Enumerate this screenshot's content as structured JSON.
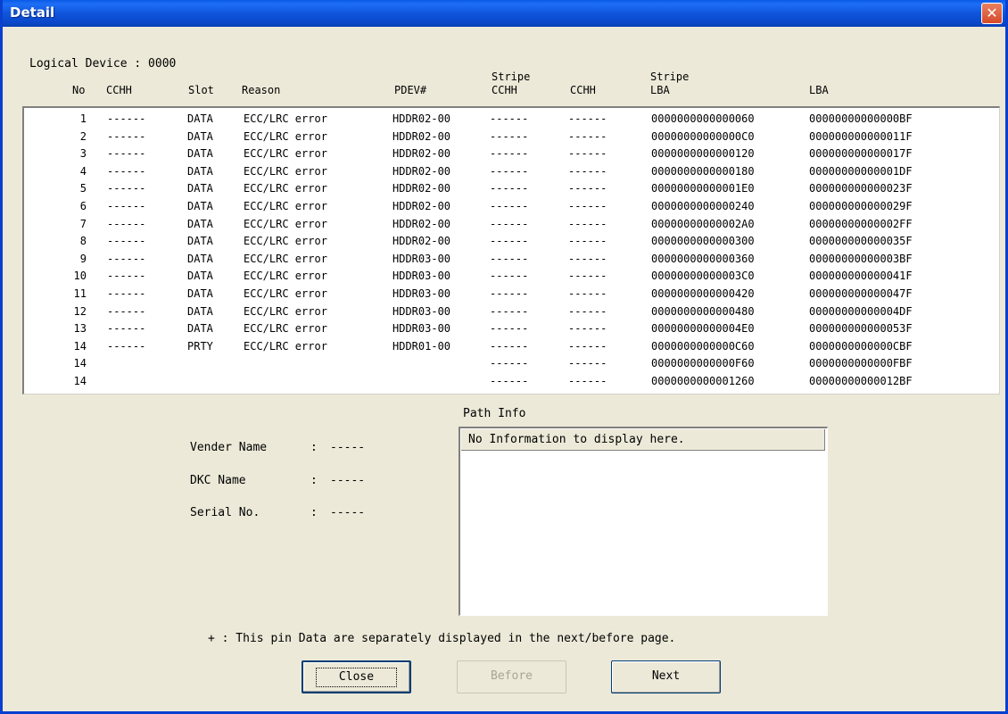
{
  "window": {
    "title": "Detail",
    "close_glyph": "✕"
  },
  "logical_device": "Logical Device : 0000",
  "columns": {
    "no": "No",
    "cchh": "CCHH",
    "slot": "Slot",
    "reason": "Reason",
    "pdev": "PDEV#",
    "stripe_cchh_top": "Stripe",
    "stripe_cchh_bottom": "CCHH",
    "cchh2": "CCHH",
    "stripe_lba_top": "Stripe",
    "stripe_lba_bottom": "LBA",
    "lba": "LBA"
  },
  "rows": [
    {
      "no": "1",
      "cchh": "------",
      "slot": "DATA",
      "reason": "ECC/LRC error",
      "pdev": "HDDR02-00",
      "scchh": "------",
      "cchh2": "------",
      "slba": "0000000000000060",
      "lba": "00000000000000BF"
    },
    {
      "no": "2",
      "cchh": "------",
      "slot": "DATA",
      "reason": "ECC/LRC error",
      "pdev": "HDDR02-00",
      "scchh": "------",
      "cchh2": "------",
      "slba": "00000000000000C0",
      "lba": "000000000000011F"
    },
    {
      "no": "3",
      "cchh": "------",
      "slot": "DATA",
      "reason": "ECC/LRC error",
      "pdev": "HDDR02-00",
      "scchh": "------",
      "cchh2": "------",
      "slba": "0000000000000120",
      "lba": "000000000000017F"
    },
    {
      "no": "4",
      "cchh": "------",
      "slot": "DATA",
      "reason": "ECC/LRC error",
      "pdev": "HDDR02-00",
      "scchh": "------",
      "cchh2": "------",
      "slba": "0000000000000180",
      "lba": "00000000000001DF"
    },
    {
      "no": "5",
      "cchh": "------",
      "slot": "DATA",
      "reason": "ECC/LRC error",
      "pdev": "HDDR02-00",
      "scchh": "------",
      "cchh2": "------",
      "slba": "00000000000001E0",
      "lba": "000000000000023F"
    },
    {
      "no": "6",
      "cchh": "------",
      "slot": "DATA",
      "reason": "ECC/LRC error",
      "pdev": "HDDR02-00",
      "scchh": "------",
      "cchh2": "------",
      "slba": "0000000000000240",
      "lba": "000000000000029F"
    },
    {
      "no": "7",
      "cchh": "------",
      "slot": "DATA",
      "reason": "ECC/LRC error",
      "pdev": "HDDR02-00",
      "scchh": "------",
      "cchh2": "------",
      "slba": "00000000000002A0",
      "lba": "00000000000002FF"
    },
    {
      "no": "8",
      "cchh": "------",
      "slot": "DATA",
      "reason": "ECC/LRC error",
      "pdev": "HDDR02-00",
      "scchh": "------",
      "cchh2": "------",
      "slba": "0000000000000300",
      "lba": "000000000000035F"
    },
    {
      "no": "9",
      "cchh": "------",
      "slot": "DATA",
      "reason": "ECC/LRC error",
      "pdev": "HDDR03-00",
      "scchh": "------",
      "cchh2": "------",
      "slba": "0000000000000360",
      "lba": "00000000000003BF"
    },
    {
      "no": "10",
      "cchh": "------",
      "slot": "DATA",
      "reason": "ECC/LRC error",
      "pdev": "HDDR03-00",
      "scchh": "------",
      "cchh2": "------",
      "slba": "00000000000003C0",
      "lba": "000000000000041F"
    },
    {
      "no": "11",
      "cchh": "------",
      "slot": "DATA",
      "reason": "ECC/LRC error",
      "pdev": "HDDR03-00",
      "scchh": "------",
      "cchh2": "------",
      "slba": "0000000000000420",
      "lba": "000000000000047F"
    },
    {
      "no": "12",
      "cchh": "------",
      "slot": "DATA",
      "reason": "ECC/LRC error",
      "pdev": "HDDR03-00",
      "scchh": "------",
      "cchh2": "------",
      "slba": "0000000000000480",
      "lba": "00000000000004DF"
    },
    {
      "no": "13",
      "cchh": "------",
      "slot": "DATA",
      "reason": "ECC/LRC error",
      "pdev": "HDDR03-00",
      "scchh": "------",
      "cchh2": "------",
      "slba": "00000000000004E0",
      "lba": "000000000000053F"
    },
    {
      "no": "14",
      "cchh": "------",
      "slot": "PRTY",
      "reason": "ECC/LRC error",
      "pdev": "HDDR01-00",
      "scchh": "------",
      "cchh2": "------",
      "slba": "0000000000000C60",
      "lba": "0000000000000CBF"
    },
    {
      "no": "14",
      "cchh": "",
      "slot": "",
      "reason": "",
      "pdev": "",
      "scchh": "------",
      "cchh2": "------",
      "slba": "0000000000000F60",
      "lba": "0000000000000FBF"
    },
    {
      "no": "14",
      "cchh": "",
      "slot": "",
      "reason": "",
      "pdev": "",
      "scchh": "------",
      "cchh2": "------",
      "slba": "0000000000001260",
      "lba": "00000000000012BF"
    }
  ],
  "info": {
    "vender_label": "Vender Name",
    "vender_value": "-----",
    "dkc_label": "DKC Name",
    "dkc_value": "-----",
    "serial_label": "Serial No.",
    "serial_value": "-----",
    "colon": ":"
  },
  "path_info": {
    "label": "Path Info",
    "message": "No Information to display here."
  },
  "note": "+ : This pin Data are separately displayed in the next/before page.",
  "buttons": {
    "close": "Close",
    "before": "Before",
    "next": "Next"
  }
}
